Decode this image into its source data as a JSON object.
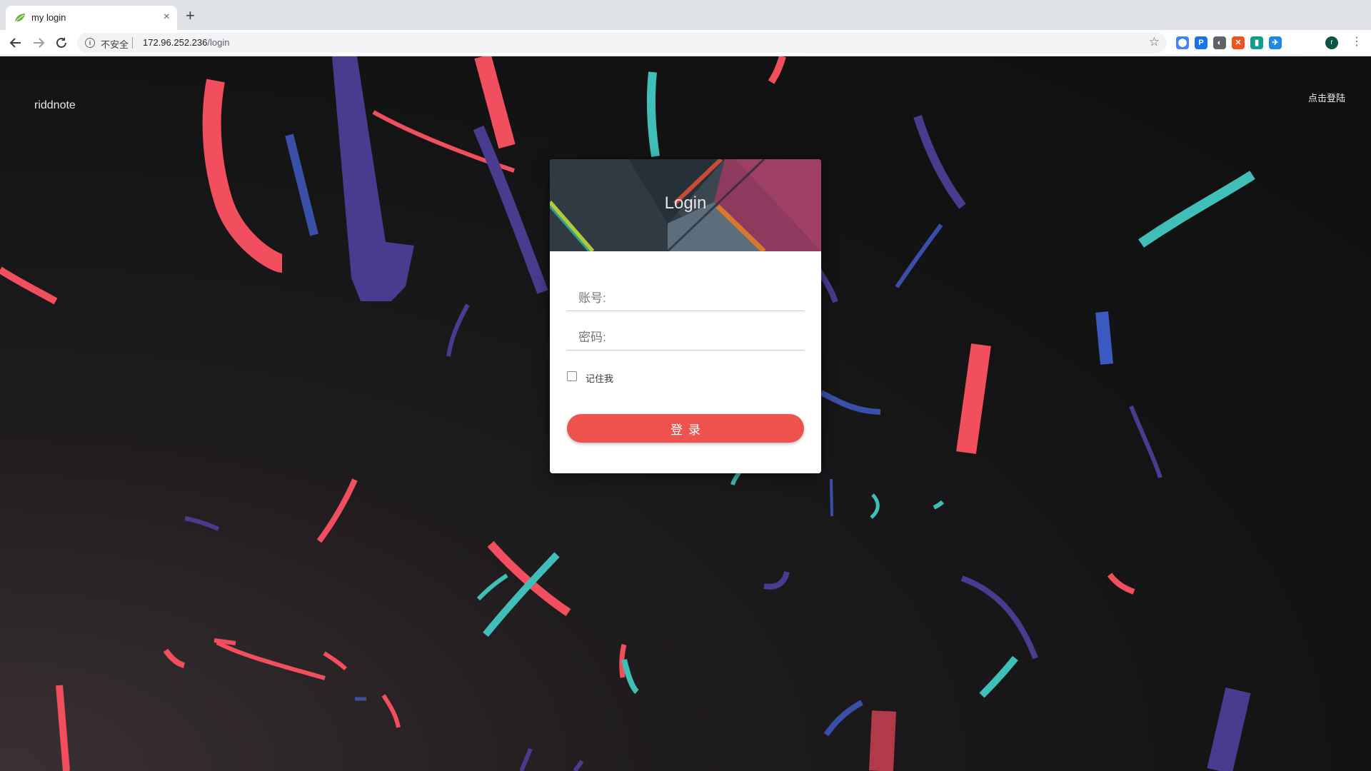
{
  "browser": {
    "tab_title": "my login",
    "close_glyph": "×",
    "new_tab_glyph": "+",
    "security_text": "不安全",
    "url_host": "172.96.252.236",
    "url_path": "/login",
    "profile_initial": "r",
    "icons": [
      "back-icon",
      "forward-icon",
      "reload-icon",
      "info-icon",
      "star-icon",
      "menu-icon"
    ],
    "extensions": [
      {
        "name": "ext-chrome-icon",
        "glyph": "⬤",
        "color": "#4285f4"
      },
      {
        "name": "ext-p-icon",
        "glyph": "P",
        "color": "#1a73e8"
      },
      {
        "name": "ext-mark-icon",
        "glyph": "◐",
        "color": "#5f6368"
      },
      {
        "name": "ext-orange-icon",
        "glyph": "✕",
        "color": "#f4511e"
      },
      {
        "name": "ext-book-icon",
        "glyph": "▮",
        "color": "#0f9d8f"
      },
      {
        "name": "ext-bird-icon",
        "glyph": "✈",
        "color": "#1e88e5"
      }
    ]
  },
  "page": {
    "brand": "riddnote",
    "signin_link": "点击登陆"
  },
  "login": {
    "title": "Login",
    "username_label": "账号:",
    "password_label": "密码:",
    "remember_label": "记住我",
    "submit_label": "登录",
    "accent_color": "#ef5350"
  }
}
